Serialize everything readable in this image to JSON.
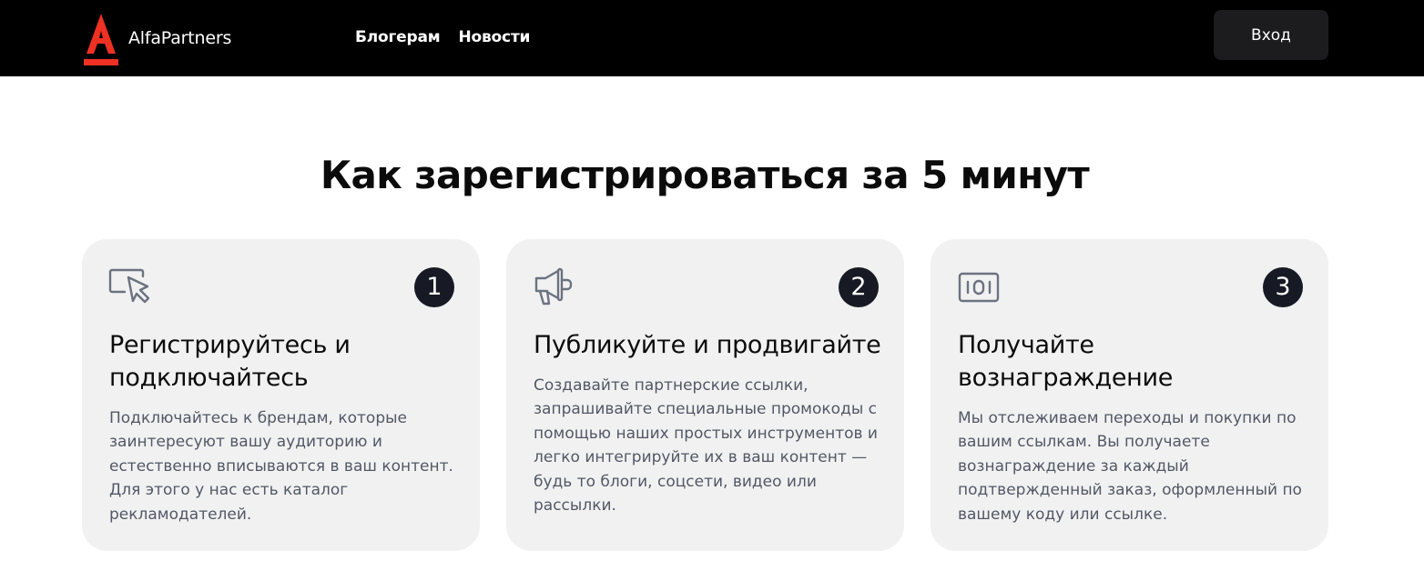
{
  "header": {
    "logo_letter": "А",
    "logo_text": "AlfaPartners",
    "nav": [
      "Блогерам",
      "Новости"
    ],
    "login_label": "Вход",
    "brand_color": "#ef3124",
    "background": "#000000"
  },
  "main": {
    "title": "Как зарегистрироваться за 5 минут",
    "steps": [
      {
        "number": "1",
        "icon": "cursor-click-icon",
        "title": "Регистрируйтесь и подключайтесь",
        "text": "Подключайтесь к брендам, которые заинтересуют вашу аудиторию и естественно вписываются в ваш контент. Для этого у нас есть каталог рекламодателей."
      },
      {
        "number": "2",
        "icon": "megaphone-icon",
        "title": "Публикуйте и продвигайте",
        "text": "Создавайте партнерские ссылки, запрашивайте специальные промокоды с помощью наших простых инструментов и легко интегрируйте их в ваш контент — будь то блоги, соцсети, видео или рассылки."
      },
      {
        "number": "3",
        "icon": "banknote-icon",
        "title": "Получайте вознаграждение",
        "text": "Мы отслеживаем переходы и покупки по вашим ссылкам. Вы получаете вознаграждение за каждый подтвержденный заказ, оформленный по вашему коду или ссылке."
      }
    ]
  }
}
